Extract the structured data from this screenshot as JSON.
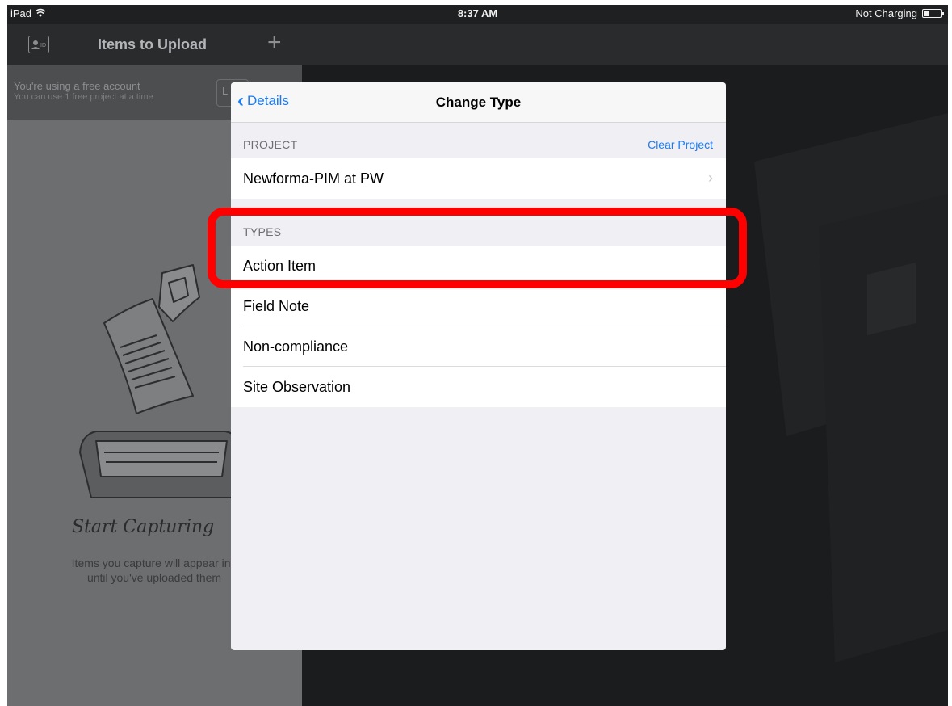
{
  "status_bar": {
    "device": "iPad",
    "time": "8:37 AM",
    "battery_status": "Not Charging",
    "battery_level": 0.35
  },
  "left_pane": {
    "title": "Items to Upload",
    "banner_line1": "You're using a free account",
    "banner_line2": "You can use 1 free project at a time",
    "banner_button": "L",
    "capture_title": "Start Capturing",
    "capture_desc_line1": "Items you capture will appear in t",
    "capture_desc_line2": "until you've uploaded them"
  },
  "modal": {
    "back_label": "Details",
    "title": "Change Type",
    "project_header": "PROJECT",
    "clear_project": "Clear Project",
    "project_name": "Newforma-PIM at PW",
    "types_header": "TYPES",
    "types": [
      {
        "label": "Action Item"
      },
      {
        "label": "Field Note"
      },
      {
        "label": "Non-compliance"
      },
      {
        "label": "Site Observation"
      }
    ]
  },
  "colors": {
    "accent": "#1a7cf5",
    "highlight": "#ff0000"
  },
  "icons": {
    "wifi": "wifi-icon",
    "battery": "battery-icon",
    "id_card": "id-card-icon",
    "plus": "plus-icon",
    "back": "chevron-left-icon",
    "disclosure": "chevron-right-icon"
  }
}
